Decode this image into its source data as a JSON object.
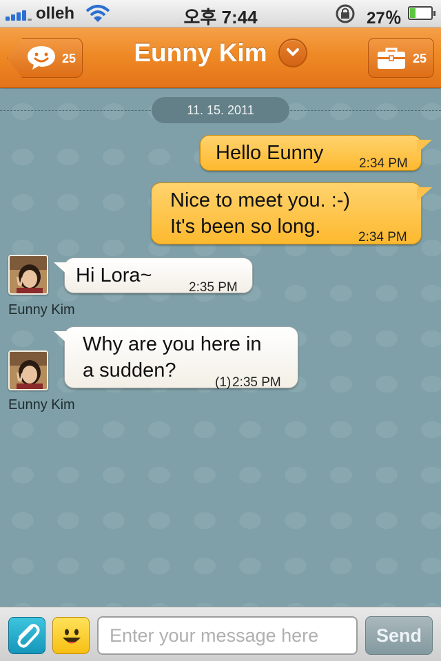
{
  "status_bar": {
    "carrier": "olleh",
    "time": "오후 7:44",
    "battery_text": "27％",
    "battery_level": 0.27,
    "icons": [
      "signal-icon",
      "wifi-icon",
      "rotation-lock-icon",
      "battery-icon"
    ]
  },
  "nav": {
    "title": "Eunny Kim",
    "back_count": "25",
    "tools_count": "25",
    "colors": {
      "bar": "#ee8a25",
      "bar_dark": "#e4731a"
    }
  },
  "chat": {
    "date": "11. 15. 2011",
    "messages": [
      {
        "direction": "out",
        "lines": [
          "Hello Eunny"
        ],
        "time": "2:34 PM"
      },
      {
        "direction": "out",
        "lines": [
          "Nice to meet you. :-)",
          "It's been so long."
        ],
        "time": "2:34 PM"
      },
      {
        "direction": "in",
        "sender": "Eunny Kim",
        "lines": [
          "Hi Lora~"
        ],
        "time": "2:35 PM"
      },
      {
        "direction": "in",
        "sender": "Eunny Kim",
        "lines": [
          "Why are you here in",
          "a sudden?"
        ],
        "unread": "(1)",
        "time": "2:35 PM"
      }
    ],
    "colors": {
      "outgoing": "#fdb92f",
      "incoming": "#ffffff",
      "background": "#7fa0a8"
    }
  },
  "input": {
    "placeholder": "Enter your message here",
    "value": "",
    "send_label": "Send"
  }
}
